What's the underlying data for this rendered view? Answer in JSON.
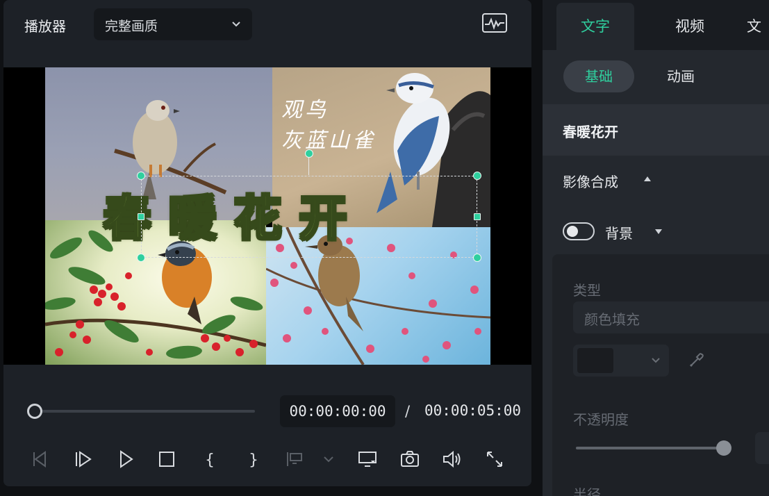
{
  "player": {
    "title": "播放器",
    "quality": "完整画质",
    "current_time": "00:00:00:00",
    "separator": "/",
    "duration": "00:00:05:00",
    "seek_progress": 0
  },
  "preview": {
    "caption_line1": "观鸟",
    "caption_line2": "灰蓝山雀",
    "title_text": "春暖花开"
  },
  "props": {
    "tabs": [
      {
        "label": "文字"
      },
      {
        "label": "视频"
      },
      {
        "label": "文"
      }
    ],
    "subtabs": [
      {
        "label": "基础"
      },
      {
        "label": "动画"
      }
    ],
    "clip_name": "春暖花开",
    "composite_label": "影像合成",
    "background_label": "背景",
    "background_enabled": false,
    "type_label": "类型",
    "type_value": "颜色填充",
    "opacity_label": "不透明度",
    "opacity_value": 1.0,
    "radius_label": "半径"
  },
  "colors": {
    "accent": "#2fcf9e",
    "panel": "#1d2127",
    "title_fill": "#86a84a",
    "title_stroke": "#364a1b"
  }
}
